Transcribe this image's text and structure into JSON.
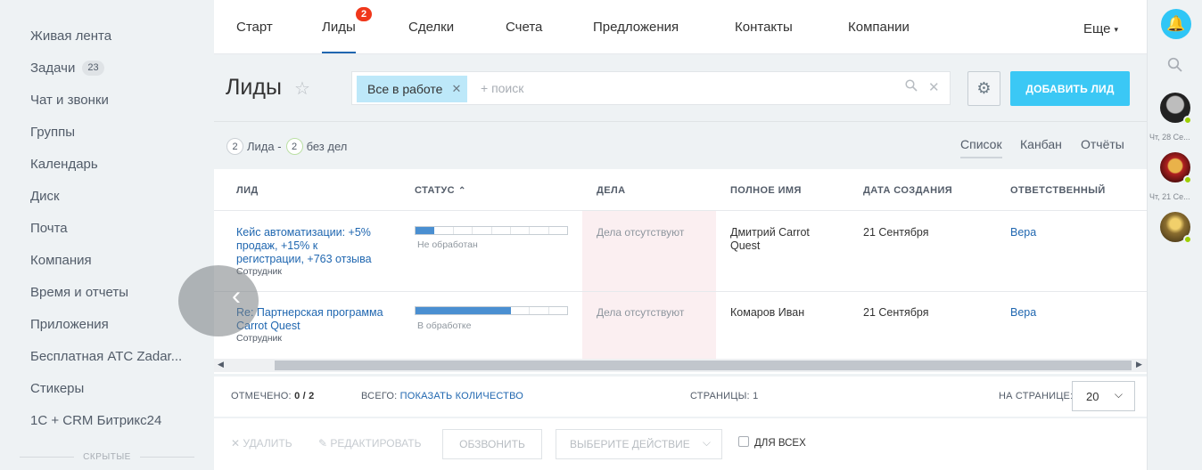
{
  "sidebar": {
    "items": [
      {
        "label": "Живая лента"
      },
      {
        "label": "Задачи",
        "counter": "23"
      },
      {
        "label": "Чат и звонки"
      },
      {
        "label": "Группы"
      },
      {
        "label": "Календарь"
      },
      {
        "label": "Диск"
      },
      {
        "label": "Почта"
      },
      {
        "label": "Компания"
      },
      {
        "label": "Время и отчеты"
      },
      {
        "label": "Приложения"
      },
      {
        "label": "Бесплатная АТС Zadar..."
      },
      {
        "label": "Стикеры"
      },
      {
        "label": "1С + CRM Битрикс24"
      }
    ],
    "hidden_label": "Скрытые"
  },
  "topnav": {
    "tabs": [
      {
        "label": "Старт"
      },
      {
        "label": "Лиды",
        "badge": "2",
        "active": true
      },
      {
        "label": "Сделки"
      },
      {
        "label": "Счета"
      },
      {
        "label": "Предложения"
      },
      {
        "label": "Контакты"
      },
      {
        "label": "Компании"
      }
    ],
    "more_label": "Еще"
  },
  "page": {
    "title": "Лиды",
    "filter_tag": "Все в работе",
    "search_placeholder": "+ поиск",
    "add_button": "ДОБАВИТЬ ЛИД"
  },
  "counters": {
    "leads_count": "2",
    "leads_text": "Лида -",
    "no_activity_count": "2",
    "no_activity_text": "без дел"
  },
  "views": {
    "list": "Список",
    "kanban": "Канбан",
    "reports": "Отчёты"
  },
  "table": {
    "headers": {
      "lead": "Лид",
      "status": "Статус",
      "activities": "Дела",
      "full_name": "Полное имя",
      "created": "Дата создания",
      "responsible": "Ответственный"
    },
    "rows": [
      {
        "title": "Кейс автоматизации: +5% продаж, +15% к регистрации, +763 отзыва",
        "sub": "Сотрудник",
        "status_text": "Не обработан",
        "status_progress": 0.125,
        "activities": "Дела отсутствуют",
        "full_name": "Дмитрий Carrot Quest",
        "created": "21 Сентября",
        "responsible": "Вера"
      },
      {
        "title": "Re: Партнерская программа Carrot Quest",
        "sub": "Сотрудник",
        "status_text": "В обработке",
        "status_progress": 0.625,
        "activities": "Дела отсутствуют",
        "full_name": "Комаров Иван",
        "created": "21 Сентября",
        "responsible": "Вера"
      }
    ]
  },
  "footer": {
    "selected_label": "Отмечено:",
    "selected_value": "0 / 2",
    "total_label": "Всего:",
    "total_link": "Показать количество",
    "pages_label": "Страницы:",
    "pages_value": "1",
    "per_page_label": "На странице:",
    "per_page_value": "20"
  },
  "actions": {
    "delete": "Удалить",
    "edit": "Редактировать",
    "call": "Обзвонить",
    "choose_action": "Выберите действие",
    "for_all": "Для всех"
  },
  "rightbar": {
    "dates": [
      "Чт, 28 Се...",
      "Чт, 21 Се..."
    ]
  },
  "colors": {
    "accent": "#3bc8f5",
    "link": "#2067b0",
    "badge": "#f0371b",
    "progress": "#4a8fd1",
    "no_activity_bg": "#fbeff1"
  }
}
